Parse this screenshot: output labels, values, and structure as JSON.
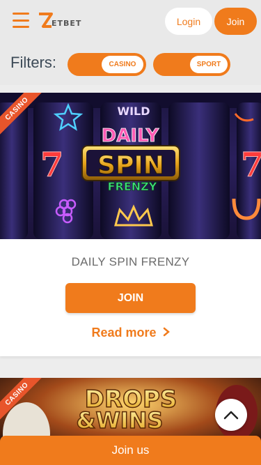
{
  "header": {
    "logo_text": "ETBET",
    "login_label": "Login",
    "join_label": "Join"
  },
  "filters": {
    "label": "Filters:",
    "casino_label": "CASINO",
    "sport_label": "SPORT"
  },
  "promotions": [
    {
      "category": "CASINO",
      "banner_title_line1": "DAILY",
      "banner_title_line2": "SPIN",
      "banner_title_line3": "FRENZY",
      "banner_top_text": "WILD",
      "title": "DAILY SPIN FRENZY",
      "join_label": "JOIN",
      "read_more_label": "Read more"
    },
    {
      "category": "CASINO",
      "banner_title_line1": "DROPS",
      "banner_title_line2": "&WINS"
    }
  ],
  "footer": {
    "join_us_label": "Join us"
  },
  "colors": {
    "accent": "#f07b1c",
    "ribbon": "#e8552b",
    "background": "#ededed"
  }
}
